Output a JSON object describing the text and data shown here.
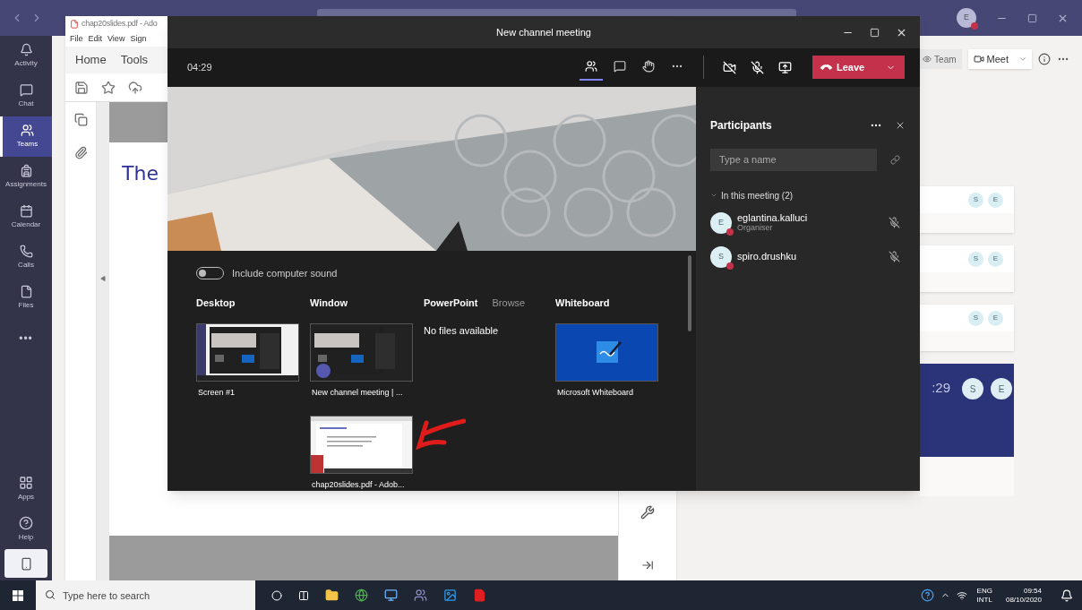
{
  "teams": {
    "avatar": "E",
    "rail": [
      {
        "kind": "activity",
        "label": "Activity",
        "selected": false
      },
      {
        "kind": "chat",
        "label": "Chat",
        "selected": false
      },
      {
        "kind": "teams",
        "label": "Teams",
        "selected": true
      },
      {
        "kind": "assignments",
        "label": "Assignments",
        "selected": false
      },
      {
        "kind": "calendar",
        "label": "Calendar",
        "selected": false
      },
      {
        "kind": "calls",
        "label": "Calls",
        "selected": false
      },
      {
        "kind": "files",
        "label": "Files",
        "selected": false
      },
      {
        "kind": "more",
        "label": "•••",
        "selected": false
      }
    ],
    "rail_bottom": [
      {
        "kind": "apps",
        "label": "Apps"
      },
      {
        "kind": "help",
        "label": "Help"
      }
    ],
    "header": {
      "team": "Team",
      "meet": "Meet"
    },
    "cards": [
      {
        "kind": "plain",
        "avatars": [
          "S",
          "E"
        ]
      },
      {
        "kind": "plain",
        "avatars": [
          "S",
          "E"
        ]
      },
      {
        "kind": "plain",
        "avatars": [
          "S",
          "E"
        ]
      },
      {
        "kind": "active",
        "time": ":29",
        "avatars": [
          "S",
          "E"
        ]
      }
    ]
  },
  "acrobat": {
    "title": "chap20slides.pdf - Ado",
    "menu": [
      "File",
      "Edit",
      "View",
      "Sign"
    ],
    "tabs": [
      "Home",
      "Tools"
    ],
    "page_heading": "The"
  },
  "meeting": {
    "title": "New channel meeting",
    "timer": "04:29",
    "toolbar": [
      {
        "kind": "participants",
        "selected": true
      },
      {
        "kind": "chat",
        "selected": false
      },
      {
        "kind": "hand",
        "selected": false
      },
      {
        "kind": "more",
        "selected": false
      }
    ],
    "leave": "Leave",
    "computer_sound": {
      "label": "Include computer sound",
      "on": false
    },
    "share": [
      {
        "title": "Desktop",
        "items": [
          {
            "kind": "screen",
            "label": "Screen #1"
          }
        ]
      },
      {
        "title": "Window",
        "items": [
          {
            "kind": "meeting",
            "label": "New channel meeting | ..."
          },
          {
            "kind": "pdf",
            "label": "chap20slides.pdf - Adob..."
          }
        ]
      },
      {
        "title": "PowerPoint",
        "action": "Browse",
        "empty": "No files available"
      },
      {
        "title": "Whiteboard",
        "items": [
          {
            "kind": "whiteboard",
            "label": "Microsoft Whiteboard"
          }
        ]
      }
    ],
    "participants": {
      "title": "Participants",
      "placeholder": "Type a name",
      "group": {
        "label": "In this meeting (2)",
        "expanded": true
      },
      "people": [
        {
          "initial": "E",
          "name": "eglantina.kalluci",
          "role": "Organiser",
          "muted": true
        },
        {
          "initial": "S",
          "name": "spiro.drushku",
          "muted": true
        }
      ]
    }
  },
  "taskbar": {
    "placeholder": "Type here to search",
    "language": "ENG",
    "layout": "INTL",
    "time": "09:54",
    "date": "08/10/2020"
  }
}
